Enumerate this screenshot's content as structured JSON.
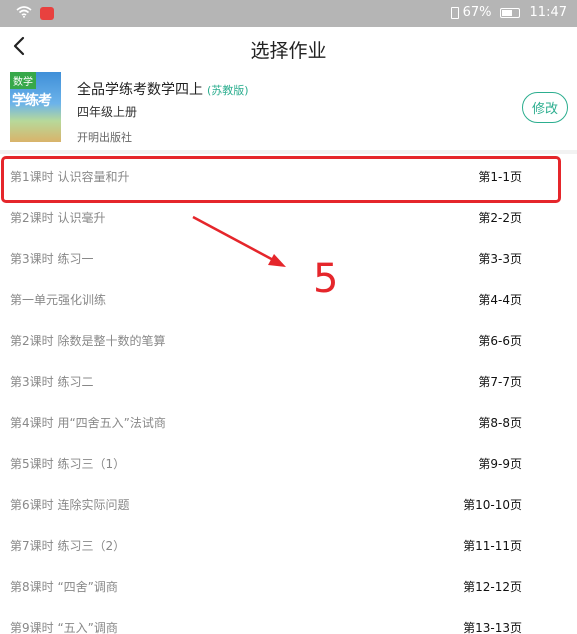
{
  "status_bar": {
    "battery_percent": "67%",
    "time": "11:47",
    "battery_level": 0.67,
    "icons": [
      "wifi-icon",
      "app-notification-icon",
      "vibrate-icon",
      "battery-icon"
    ]
  },
  "header": {
    "title": "选择作业",
    "back_icon": "chevron-left-icon"
  },
  "book": {
    "cover_tag": "数学",
    "cover_title": "学练考",
    "title": "全品学练考数学四上",
    "edition": "(苏教版)",
    "grade": "四年级上册",
    "publisher": "开明出版社",
    "modify_label": "修改"
  },
  "lessons": [
    {
      "title": "第1课时 认识容量和升",
      "pages": "第1-1页"
    },
    {
      "title": "第2课时 认识毫升",
      "pages": "第2-2页"
    },
    {
      "title": "第3课时 练习一",
      "pages": "第3-3页"
    },
    {
      "title": "第一单元强化训练",
      "pages": "第4-4页"
    },
    {
      "title": "第2课时 除数是整十数的笔算",
      "pages": "第6-6页"
    },
    {
      "title": "第3课时 练习二",
      "pages": "第7-7页"
    },
    {
      "title": "第4课时 用“四舍五入”法试商",
      "pages": "第8-8页"
    },
    {
      "title": "第5课时 练习三（1）",
      "pages": "第9-9页"
    },
    {
      "title": "第6课时 连除实际问题",
      "pages": "第10-10页"
    },
    {
      "title": "第7课时 练习三（2）",
      "pages": "第11-11页"
    },
    {
      "title": "第8课时 “四舍”调商",
      "pages": "第12-12页"
    },
    {
      "title": "第9课时 “五入”调商",
      "pages": "第13-13页"
    }
  ],
  "annotation": {
    "number": "5",
    "color": "#e5262b"
  },
  "colors": {
    "accent": "#2cae8f",
    "annotation": "#e5262b",
    "status_bar": "#b5b5b5"
  }
}
